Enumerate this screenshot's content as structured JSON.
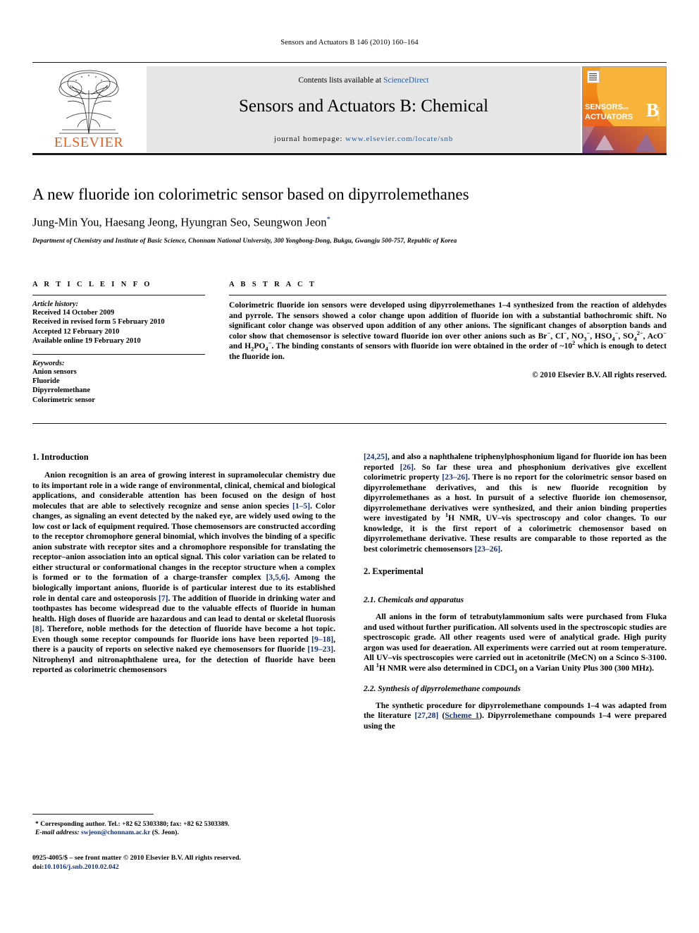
{
  "running_head": "Sensors and Actuators B 146 (2010) 160–164",
  "masthead": {
    "contents_prefix": "Contents lists available at ",
    "sciencedirect": "ScienceDirect",
    "journal_title": "Sensors and Actuators B: Chemical",
    "homepage_label": "journal homepage:",
    "homepage_url": "www.elsevier.com/locate/snb",
    "publisher": "ELSEVIER",
    "cover_title_line1": "SENSORS",
    "cover_title_and": "and",
    "cover_title_line2": "ACTUATORS",
    "cover_letter": "B",
    "cover_sub": "Chemical",
    "link_color": "#1b5faa",
    "elsevier_orange": "#E8601C"
  },
  "article": {
    "title": "A new fluoride ion colorimetric sensor based on dipyrrolemethanes",
    "authors": "Jung-Min You, Haesang Jeong, Hyungran Seo, Seungwon Jeon",
    "corresponding_marker": "*",
    "affiliation": "Department of Chemistry and Institute of Basic Science, Chonnam National University, 300 Yongbong-Dong, Bukgu, Gwangju 500-757, Republic of Korea"
  },
  "article_info": {
    "heading": "A R T I C L E     I N F O",
    "history_label": "Article history:",
    "history": [
      "Received 14 October 2009",
      "Received in revised form 5 February 2010",
      "Accepted 12 February 2010",
      "Available online 19 February 2010"
    ],
    "keywords_label": "Keywords:",
    "keywords": [
      "Anion sensors",
      "Fluoride",
      "Dipyrrolemethane",
      "Colorimetric sensor"
    ]
  },
  "abstract": {
    "heading": "A B S T R A C T",
    "p1_a": "Colorimetric fluoride ion sensors were developed using dipyrrolemethanes 1–4 synthesized from the reaction of aldehydes and pyrrole. The sensors showed a color change upon addition of fluoride ion with a substantial bathochromic shift. No significant color change was observed upon addition of any other anions. The significant changes of absorption bands and color show that chemosensor is selective toward fluoride ion over other anions such as Br",
    "anion_br_sup": "−",
    "p1_b": ", Cl",
    "anion_cl_sup": "−",
    "p1_c": ", NO",
    "no3_sub": "3",
    "no3_sup": "−",
    "p1_d": ", HSO",
    "hso4_sub": "4",
    "hso4_sup": "−",
    "p1_e": ", SO",
    "so4_sub": "4",
    "so4_sup": "2−",
    "p1_f": ", AcO",
    "aco_sup": "−",
    "p1_g": " and H",
    "h2po4_sub1": "2",
    "p1_h": "PO",
    "h2po4_sub2": "4",
    "h2po4_sup": "−",
    "p1_i": ". The binding constants of sensors with fluoride ion were obtained in the order of ~10",
    "order_sup": "2",
    "p1_j": " which is enough to detect the fluoride ion.",
    "copyright": "© 2010 Elsevier B.V. All rights reserved."
  },
  "sections": {
    "introduction_heading": "1.  Introduction",
    "intro_p1_a": "Anion recognition is an area of growing interest in supramolecular chemistry due to its important role in a wide range of environmental, clinical, chemical and biological applications, and considerable attention has been focused on the design of host molecules that are able to selectively recognize and sense anion species ",
    "intro_cite_1_5": "[1–5]",
    "intro_p1_b": ". Color changes, as signaling an event detected by the naked eye, are widely used owing to the low cost or lack of equipment required. Those chemosensors are constructed according to the receptor chromophore general binomial, which involves the binding of a specific anion substrate with receptor sites and a chromophore responsible for translating the receptor–anion association into an optical signal. This color variation can be related to either structural or conformational changes in the receptor structure when a complex is formed or to the formation of a charge-transfer complex ",
    "intro_cite_356": "[3,5,6]",
    "intro_p1_c": ". Among the biologically important anions, fluoride is of particular interest due to its established role in dental care and osteoporosis ",
    "intro_cite_7": "[7]",
    "intro_p1_d": ". The addition of fluoride in drinking water and toothpastes has become widespread due to the valuable effects of fluoride in human health. High doses of fluoride are hazardous and can lead to dental or skeletal fluorosis ",
    "intro_cite_8": "[8]",
    "intro_p1_e": ". Therefore, noble methods for the detection of fluoride have become a hot topic. Even though some receptor compounds for fluoride ions have been reported ",
    "intro_cite_9_18": "[9–18]",
    "intro_p1_f": ", there is a paucity of reports on selective naked eye chemosensors for fluoride ",
    "intro_cite_19_23": "[19–23]",
    "intro_p1_g": ". Nitrophenyl and nitronaphthalene urea, for the detection of fluoride have been reported as colorimetric chemosensors ",
    "intro_cite_24_25": "[24,25]",
    "intro_p1_h": ", and also a naphthalene triphenylphosphonium ligand for fluoride ion has been reported ",
    "intro_cite_26": "[26]",
    "intro_p1_i": ". So far these urea and phosphonium derivatives give excellent colorimetric property ",
    "intro_cite_23_26": "[23–26]",
    "intro_p1_j": ". There is no report for the colorimetric sensor based on dipyrrolemethane derivatives, and this is new fluoride recognition by dipyrrolemethanes as a host. In pursuit of a selective fluoride ion chemosensor, dipyrrolemethane derivatives were synthesized, and their anion binding properties were investigated by ",
    "nmr_sup": "1",
    "intro_p1_k": "H NMR, UV–vis spectroscopy and color changes. To our knowledge, it is the first report of a colorimetric chemosensor based on dipyrrolemethane derivative. These results are comparable to those reported as the best colorimetric chemosensors ",
    "intro_cite_23_26b": "[23–26]",
    "intro_p1_l": ".",
    "experimental_heading": "2.  Experimental",
    "sub21_heading": "2.1.  Chemicals and apparatus",
    "sub21_p_a": "All anions in the form of tetrabutylammonium salts were purchased from Fluka and used without further purification. All solvents used in the spectroscopic studies are spectroscopic grade. All other reagents used were of analytical grade. High purity argon was used for deaeration. All experiments were carried out at room temperature. All UV–vis spectroscopies were carried out in acetonitrile (MeCN) on a Scinco S-3100. All ",
    "sub21_nmr_sup": "1",
    "sub21_p_b": "H NMR were also determined in CDCl",
    "cdcl3_sub": "3",
    "sub21_p_c": " on a Varian Unity Plus 300 (300 MHz).",
    "sub22_heading": "2.2.  Synthesis of dipyrrolemethane compounds",
    "sub22_p_a": "The synthetic procedure for dipyrrolemethane compounds 1–4 was adapted from the literature ",
    "sub22_cite_27_28": "[27,28]",
    "sub22_p_b": " (",
    "sub22_scheme_link": "Scheme 1",
    "sub22_p_c": "). Dipyrrolemethane compounds 1–4 were prepared using the"
  },
  "footnotes": {
    "corresponding": "* Corresponding author. Tel.: +82 62 5303380; fax: +82 62 5303389.",
    "email_label": "E-mail address:",
    "email": "swjeon@chonnam.ac.kr",
    "email_suffix": "(S. Jeon).",
    "imprint": "0925-4005/$ – see front matter © 2010 Elsevier B.V. All rights reserved.",
    "doi_label": "doi:",
    "doi": "10.1016/j.snb.2010.02.042"
  }
}
